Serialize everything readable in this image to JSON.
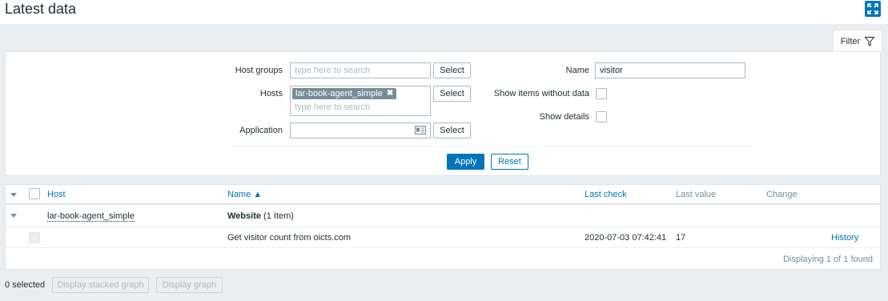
{
  "page": {
    "title": "Latest data"
  },
  "header": {
    "fullscreen_icon": "expand-arrows-icon"
  },
  "filter_tab": {
    "label": "Filter",
    "icon": "funnel-icon"
  },
  "filter": {
    "host_groups": {
      "label": "Host groups",
      "placeholder": "type here to search",
      "select_label": "Select"
    },
    "hosts": {
      "label": "Hosts",
      "selected_tag": "lar-book-agent_simple",
      "placeholder": "type here to search",
      "select_label": "Select"
    },
    "application": {
      "label": "Application",
      "value": "",
      "select_label": "Select",
      "icon": "id-card-icon"
    },
    "name": {
      "label": "Name",
      "value": "visitor"
    },
    "show_items_without_data": {
      "label": "Show items without data",
      "checked": false
    },
    "show_details": {
      "label": "Show details",
      "checked": false
    },
    "apply_label": "Apply",
    "reset_label": "Reset"
  },
  "table": {
    "columns": {
      "host": "Host",
      "name": "Name ▲",
      "last_check": "Last check",
      "last_value": "Last value",
      "change": "Change"
    },
    "group_row": {
      "host": "lar-book-agent_simple",
      "application": "Website",
      "count": "(1 Item)"
    },
    "rows": [
      {
        "name": "Get visitor count from oicts.com",
        "last_check": "2020-07-03 07:42:41",
        "last_value": "17",
        "change": "",
        "action": "History"
      }
    ],
    "footer": "Displaying 1 of 1 found"
  },
  "bottom": {
    "selected": "0 selected",
    "stacked_graph_label": "Display stacked graph",
    "graph_label": "Display graph"
  },
  "colors": {
    "accent": "#0275b8",
    "background": "#ebeef0",
    "tag": "#768d99"
  }
}
